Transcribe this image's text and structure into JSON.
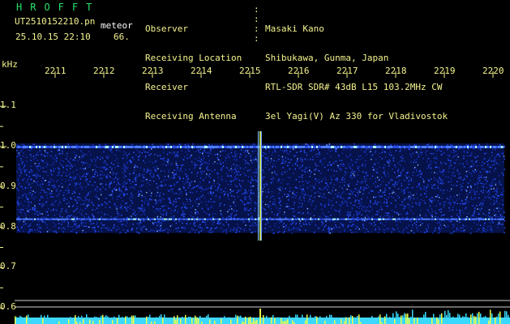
{
  "header": {
    "title": "HROFFT",
    "filename": "UT2510152210.pn",
    "meteor_label": "meteor",
    "datetime": "25.10.15 22:10",
    "count": "66.",
    "field_labels": [
      "Observer",
      "Receiving Location",
      "Receiver",
      "Receiving Antenna"
    ],
    "field_values": [
      "Masaki Kano",
      "Shibukawa, Gunma, Japan",
      "RTL-SDR SDR# 43dB L15 103.2MHz CW",
      "3el Yagi(V) Az 330 for Vladivostok"
    ]
  },
  "axes": {
    "y_unit": "kHz",
    "y_ticks": [
      "1.1",
      "1.0",
      "0.9",
      "0.8",
      "0.7",
      "0.6"
    ],
    "x_ticks": [
      "2211",
      "2212",
      "2213",
      "2214",
      "2215",
      "2216",
      "2217",
      "2218",
      "2219",
      "2220"
    ]
  },
  "spectrogram": {
    "freq_band_khz": [
      0.79,
      1.0
    ],
    "carrier_lines_khz": [
      1.0,
      0.82
    ],
    "meteor_echo_minute": 2215.3,
    "colors": {
      "text_green": "#27e06a",
      "text_yellow": "#f4f38e",
      "noise_blue": "#1a3cff",
      "signal_cyan": "#7ff6ff"
    }
  }
}
